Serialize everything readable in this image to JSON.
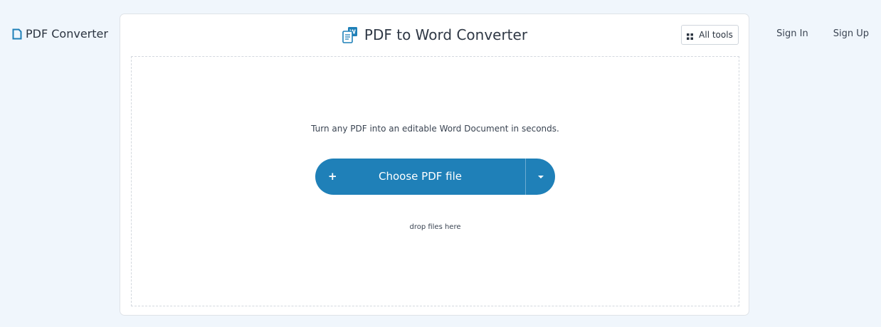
{
  "brand": {
    "name": "PDF Converter",
    "icon": "document-icon"
  },
  "auth": {
    "sign_in": "Sign In",
    "sign_up": "Sign Up"
  },
  "header": {
    "title": "PDF to Word Converter",
    "title_icon": "pdf-to-word-icon",
    "all_tools_label": "All tools",
    "all_tools_icon": "grid-icon"
  },
  "dropzone": {
    "tagline": "Turn any PDF into an editable Word Document in seconds.",
    "choose_label": "Choose PDF file",
    "plus_symbol": "+",
    "hint": "drop files here"
  },
  "colors": {
    "accent": "#1f80b8",
    "background": "#f0f6fc"
  }
}
